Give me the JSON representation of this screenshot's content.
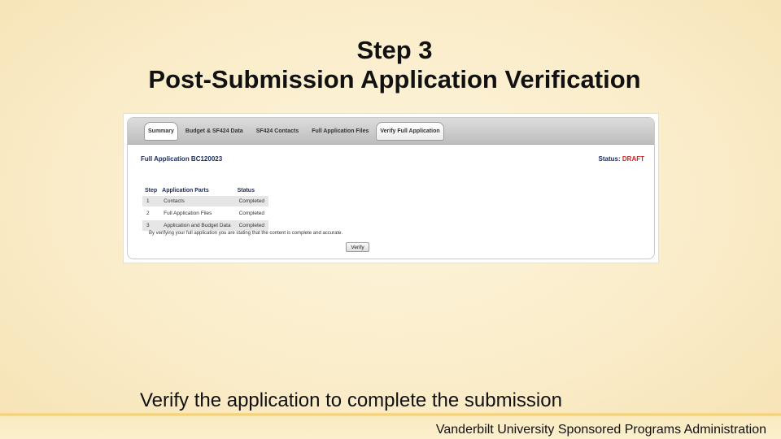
{
  "slide": {
    "title_line1": "Step 3",
    "title_line2": "Post-Submission Application Verification",
    "caption": "Verify the application to complete the submission",
    "footer": "Vanderbilt University Sponsored Programs Administration"
  },
  "app": {
    "tabs": [
      {
        "label": "Summary"
      },
      {
        "label": "Budget & SF424 Data"
      },
      {
        "label": "SF424 Contacts"
      },
      {
        "label": "Full Application Files"
      },
      {
        "label": "Verify Full Application"
      }
    ],
    "heading": "Full Application BC120023",
    "status_label": "Status:",
    "status_value": "DRAFT",
    "status_color": "#d62020",
    "table": {
      "headers": [
        "Step",
        "Application Parts",
        "Status"
      ],
      "rows": [
        {
          "step": "1",
          "part": "Contacts",
          "status": "Completed"
        },
        {
          "step": "2",
          "part": "Full Application Files",
          "status": "Completed"
        },
        {
          "step": "3",
          "part": "Application and Budget Data",
          "status": "Completed"
        }
      ]
    },
    "verify_note": "By verifying your full application you are stating that the content is complete and accurate.",
    "verify_button": "Verify"
  }
}
